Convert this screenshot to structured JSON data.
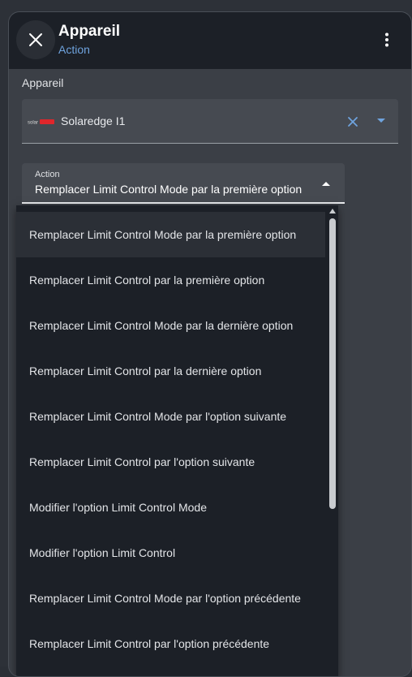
{
  "header": {
    "title": "Appareil",
    "subtitle": "Action",
    "close_icon": "close-icon",
    "more_icon": "more-vertical-icon"
  },
  "device": {
    "section_label": "Appareil",
    "selected_value": "Solaredge I1",
    "logo_text": "solaredge",
    "clear_icon": "close-icon",
    "dropdown_icon": "caret-down-icon"
  },
  "action": {
    "label": "Action",
    "value": "Remplacer Limit Control Mode par la première option",
    "dropdown_icon": "caret-up-icon"
  },
  "menu": {
    "items": [
      "Remplacer Limit Control Mode par la première option",
      "Remplacer Limit Control par la première option",
      "Remplacer Limit Control Mode par la dernière option",
      "Remplacer Limit Control par la dernière option",
      "Remplacer Limit Control Mode par l'option suivante",
      "Remplacer Limit Control par l'option suivante",
      "Modifier l'option Limit Control Mode",
      "Modifier l'option Limit Control",
      "Remplacer Limit Control Mode par l'option précédente",
      "Remplacer Limit Control par l'option précédente"
    ],
    "selected_index": 0
  },
  "colors": {
    "accent": "#6fa3de",
    "header_bg": "#1c2027",
    "dialog_bg": "#3b3f46",
    "menu_bg": "#1c2027",
    "logo_red": "#e0262b"
  }
}
